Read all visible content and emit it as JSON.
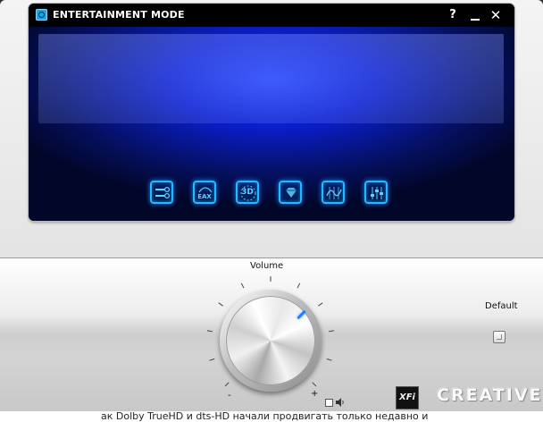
{
  "window": {
    "title": "ENTERTAINMENT MODE",
    "help_label": "?",
    "close_label": "✕"
  },
  "modes": [
    {
      "name": "mixer",
      "label": ""
    },
    {
      "name": "eax",
      "label": "EAX"
    },
    {
      "name": "3d",
      "label": "3D"
    },
    {
      "name": "crystalizer",
      "label": ""
    },
    {
      "name": "equalizer",
      "label": ""
    },
    {
      "name": "settings",
      "label": ""
    }
  ],
  "volume": {
    "label": "Volume",
    "minus": "-",
    "plus": "+",
    "level": 0.8
  },
  "default": {
    "label": "Default"
  },
  "brand": {
    "xfi": "XFi",
    "name": "CREATIVE"
  },
  "background_text": "ак Dolby TrueHD и dts-HD начали продвигать только недавно и",
  "colors": {
    "accent_glow": "#28b8ff",
    "display_blue": "#0b1fd0",
    "indicator": "#1e7fff"
  }
}
